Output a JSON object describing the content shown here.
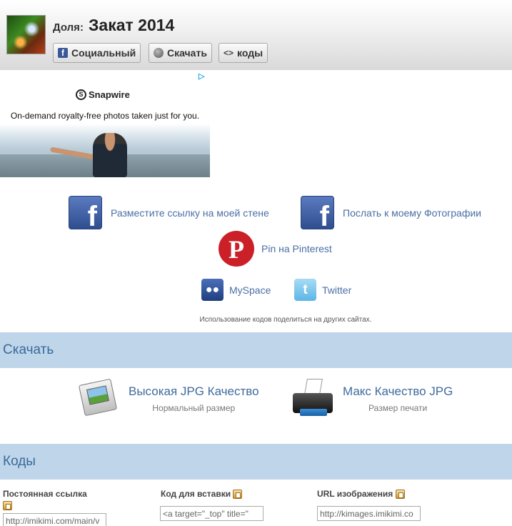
{
  "header": {
    "share_label": "Доля:",
    "title": "Закат 2014",
    "buttons": {
      "social": "Социальный",
      "download": "Скачать",
      "codes": "коды"
    }
  },
  "ad": {
    "brand": "Snapwire",
    "tagline": "On-demand royalty-free photos taken just for you."
  },
  "social": {
    "fb_wall": "Разместите ссылку на моей стене",
    "fb_photos": "Послать к моему Фотографии",
    "pinterest": "Pin на Pinterest",
    "myspace": "MySpace",
    "twitter": "Twitter",
    "note": "Использование кодов поделиться на других сайтах."
  },
  "download_section": {
    "heading": "Скачать",
    "high": {
      "title": "Высокая JPG Качество",
      "subtitle": "Нормальный размер"
    },
    "max": {
      "title": "Макс Качество JPG",
      "subtitle": "Размер печати"
    }
  },
  "codes_section": {
    "heading": "Коды",
    "permalink": {
      "label": "Постоянная ссылка",
      "value": "http://imikimi.com/main/v"
    },
    "embed": {
      "label": "Код для вставки",
      "value": "<a target=\"_top\" title=\""
    },
    "image_url": {
      "label": "URL изображения",
      "value": "http://kimages.imikimi.co"
    }
  },
  "colors": {
    "section_bg": "#bfd6ea",
    "link": "#4a6fa5",
    "facebook": "#3b5998",
    "pinterest": "#cb2027"
  },
  "icons": [
    "facebook-icon",
    "download-icon",
    "code-icon",
    "pinterest-icon",
    "myspace-icon",
    "twitter-icon",
    "image-icon",
    "printer-icon",
    "copy-icon",
    "adchoices-icon"
  ]
}
